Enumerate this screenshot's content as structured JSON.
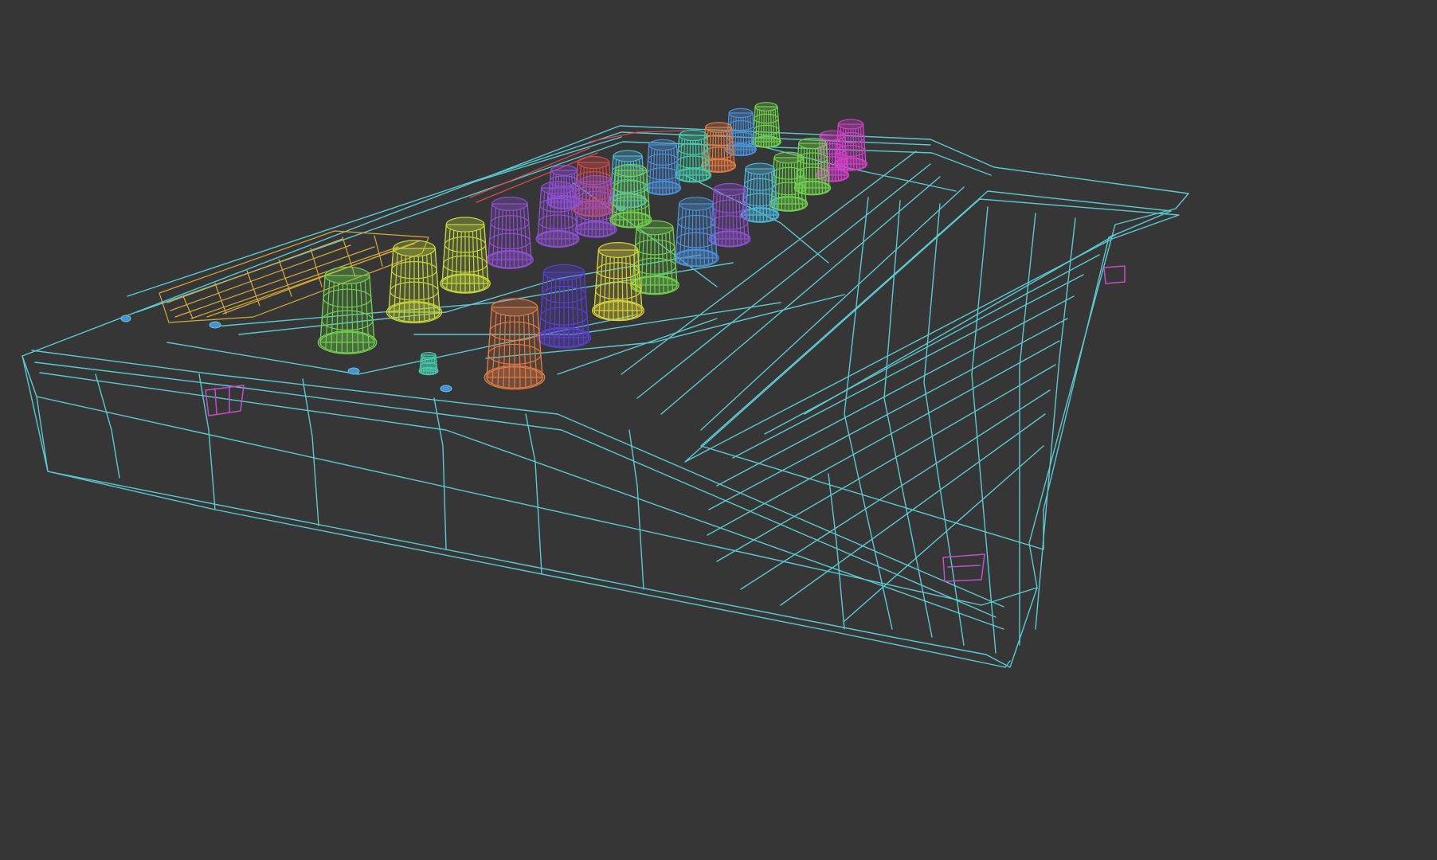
{
  "viewport": {
    "background": "#363636",
    "render_mode": "wireframe"
  },
  "scene": {
    "object": "synthesizer-keyboard",
    "colors": {
      "chassis": "#5cc8d2",
      "display": "#d9a83a",
      "connector": "#c050c8",
      "red_detail": "#d24b4b"
    },
    "knob_colors": {
      "green": "#6fcf4e",
      "lime": "#c6d63c",
      "yellow": "#d8d23a",
      "purple": "#8e4fd0",
      "indigo": "#5a3fd0",
      "orange": "#e07a45",
      "teal": "#48c8a8",
      "blue": "#4b8fd8",
      "sky": "#4bb4d8",
      "magenta": "#d040c8"
    }
  }
}
